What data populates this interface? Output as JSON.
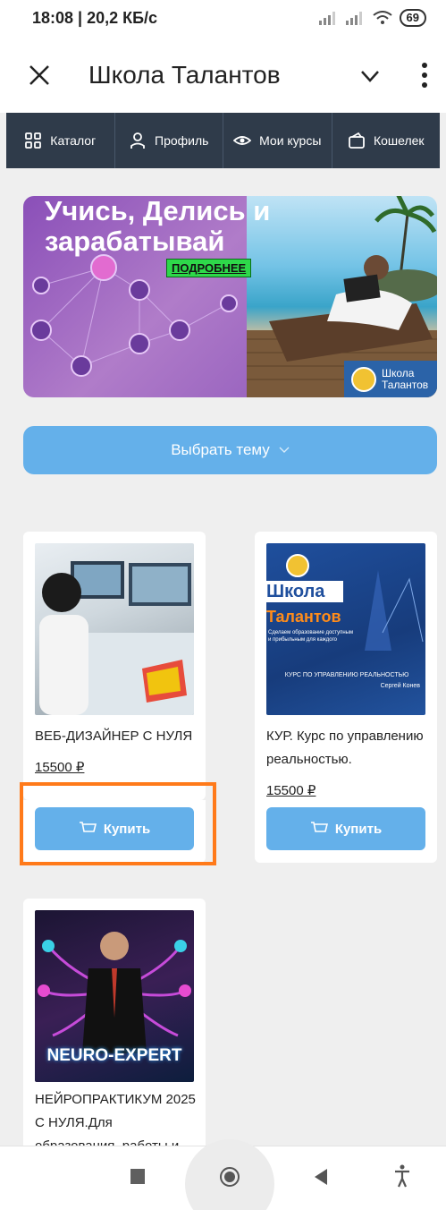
{
  "status_bar": {
    "time": "18:08 | 20,2 КБ/с",
    "battery": "69"
  },
  "app_bar": {
    "title": "Школа Талантов"
  },
  "nav": {
    "items": [
      {
        "label": "Каталог",
        "icon": "grid-icon"
      },
      {
        "label": "Профиль",
        "icon": "person-icon"
      },
      {
        "label": "Мои курсы",
        "icon": "eye-icon"
      },
      {
        "label": "Кошелек",
        "icon": "wallet-icon"
      }
    ]
  },
  "banner": {
    "headline_line1": "Учись, Делись и",
    "headline_line2": "зарабатывай",
    "more_label": "ПОДРОБНЕЕ",
    "badge_line1": "Школа",
    "badge_line2": "Талантов"
  },
  "theme_select": {
    "label": "Выбрать тему"
  },
  "products": [
    {
      "name": "ВЕБ-ДИЗАЙНЕР С НУЛЯ",
      "price": "15500 ₽",
      "buy_label": "Купить"
    },
    {
      "name": "КУР. Курс по управлению реальностью.",
      "price": "15500 ₽",
      "buy_label": "Купить",
      "image_text": {
        "school": "Школа",
        "talents": "Талантов",
        "subtitle": "Сделаем образование доступным и прибыльным для каждого",
        "course": "КУРС ПО УПРАВЛЕНИЮ РЕАЛЬНОСТЬЮ",
        "author": "Сергей Конев"
      }
    },
    {
      "name": "НЕЙРОПРАКТИКУМ 2025 С НУЛЯ.Для образования, работы и",
      "image_text": "NEURO-EXPERT"
    }
  ],
  "colors": {
    "nav_bg": "#2f3b4a",
    "accent": "#64b0ea",
    "highlight": "#ff7a1a",
    "page_bg": "#efefef"
  }
}
